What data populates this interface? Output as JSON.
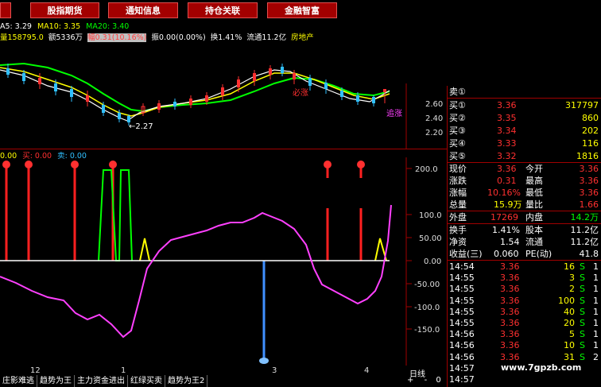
{
  "tabs": [
    "股指期货",
    "通知信息",
    "持仓关联",
    "金融智富"
  ],
  "ma": {
    "ma5": "A5: 3.29",
    "ma10": "MA10: 3.35",
    "ma20": "MA20: 3.40"
  },
  "info": {
    "vol": "量158795.0",
    "amount": "额5336万",
    "change": "幅0.31(10.16%)",
    "amplitude": "振0.00(0.00%)",
    "turnover": "换1.41%",
    "float": "流通11.2亿",
    "sector": "房地产"
  },
  "price_axis": [
    "2.60",
    "2.40",
    "2.20"
  ],
  "annotations": {
    "low": "←2.27",
    "buy": "必涨",
    "sell": "追涨"
  },
  "indicator": {
    "value": "0.00",
    "buy": "买: 0.00",
    "sell": "卖: 0.00"
  },
  "ind_axis": [
    "200.0",
    "100.0",
    "50.00",
    "0.00",
    "-50.00",
    "-100.0",
    "-150.0"
  ],
  "xaxis": [
    "12",
    "1",
    "3",
    "4"
  ],
  "bottom_tabs": [
    "庄影难逃",
    "趋势为王",
    "主力资金进出",
    "红绿买卖",
    "趋势为王2"
  ],
  "bottom_controls": [
    "+",
    "-",
    "0"
  ],
  "period": "日线",
  "orderbook": {
    "sell1_label": "卖①",
    "buys": [
      {
        "label": "买①",
        "price": "3.36",
        "vol": "317797"
      },
      {
        "label": "买②",
        "price": "3.35",
        "vol": "860"
      },
      {
        "label": "买③",
        "price": "3.34",
        "vol": "202"
      },
      {
        "label": "买④",
        "price": "3.33",
        "vol": "116"
      },
      {
        "label": "买⑤",
        "price": "3.32",
        "vol": "1816"
      }
    ]
  },
  "quote": [
    {
      "l1": "现价",
      "v1": "3.36",
      "l2": "今开",
      "v2": "3.36"
    },
    {
      "l1": "涨跌",
      "v1": "0.31",
      "l2": "最高",
      "v2": "3.36"
    },
    {
      "l1": "涨幅",
      "v1": "10.16%",
      "l2": "最低",
      "v2": "3.36"
    },
    {
      "l1": "总量",
      "v1": "15.9万",
      "l2": "量比",
      "v2": "1.66"
    }
  ],
  "outer": {
    "l1": "外盘",
    "v1": "17269",
    "l2": "内盘",
    "v2": "14.2万"
  },
  "stats": [
    {
      "l1": "换手",
      "v1": "1.41%",
      "l2": "股本",
      "v2": "11.2亿"
    },
    {
      "l1": "净资",
      "v1": "1.54",
      "l2": "流通",
      "v2": "11.2亿"
    },
    {
      "l1": "收益(三)",
      "v1": "0.060",
      "l2": "PE(动)",
      "v2": "41.8"
    }
  ],
  "ticks": [
    {
      "time": "14:54",
      "price": "3.36",
      "vol": "16",
      "side": "S",
      "n": "1"
    },
    {
      "time": "14:55",
      "price": "3.36",
      "vol": "3",
      "side": "S",
      "n": "1"
    },
    {
      "time": "14:55",
      "price": "3.36",
      "vol": "2",
      "side": "S",
      "n": "1"
    },
    {
      "time": "14:55",
      "price": "3.36",
      "vol": "100",
      "side": "S",
      "n": "1"
    },
    {
      "time": "14:55",
      "price": "3.36",
      "vol": "40",
      "side": "S",
      "n": "1"
    },
    {
      "time": "14:55",
      "price": "3.36",
      "vol": "20",
      "side": "S",
      "n": "1"
    },
    {
      "time": "14:56",
      "price": "3.36",
      "vol": "5",
      "side": "S",
      "n": "1"
    },
    {
      "time": "14:56",
      "price": "3.36",
      "vol": "10",
      "side": "S",
      "n": "1"
    },
    {
      "time": "14:56",
      "price": "3.36",
      "vol": "31",
      "side": "S",
      "n": "2"
    },
    {
      "time": "14:57",
      "price": "",
      "vol": "",
      "side": "",
      "n": ""
    },
    {
      "time": "14:57",
      "price": "",
      "vol": "",
      "side": "",
      "n": ""
    }
  ],
  "watermark": "www.7gpzb.com",
  "colors": {
    "red": "#ff3030",
    "yellow": "#ffff00",
    "green": "#00ff00",
    "magenta": "#ff40ff",
    "cyan": "#30c0ff",
    "panel_red": "#a00000"
  }
}
